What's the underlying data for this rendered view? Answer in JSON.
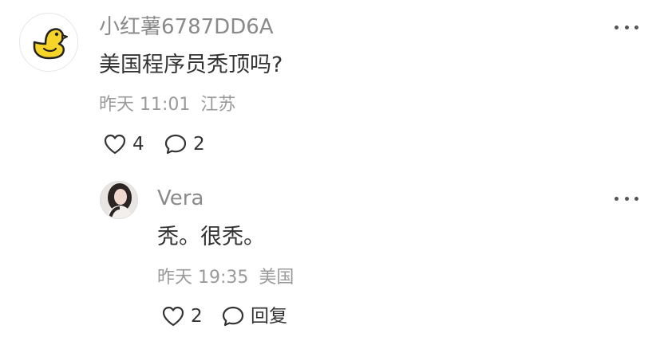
{
  "comment": {
    "username": "小红薯6787DD6A",
    "text": "美国程序员秃顶吗?",
    "time": "昨天 11:01",
    "location": "江苏",
    "like_count": "4",
    "reply_count": "2"
  },
  "reply": {
    "username": "Vera",
    "text": "秃。很秃。",
    "time": "昨天 19:35",
    "location": "美国",
    "like_count": "2",
    "reply_label": "回复"
  },
  "icons": {
    "more": "more-horizontal-icon",
    "like": "heart-outline-icon",
    "comment": "speech-bubble-icon",
    "avatar": "duck-icon"
  },
  "colors": {
    "username": "#8a8a8a",
    "text": "#333333",
    "meta": "#9a9a9a",
    "duck_yellow": "#f7d428"
  }
}
